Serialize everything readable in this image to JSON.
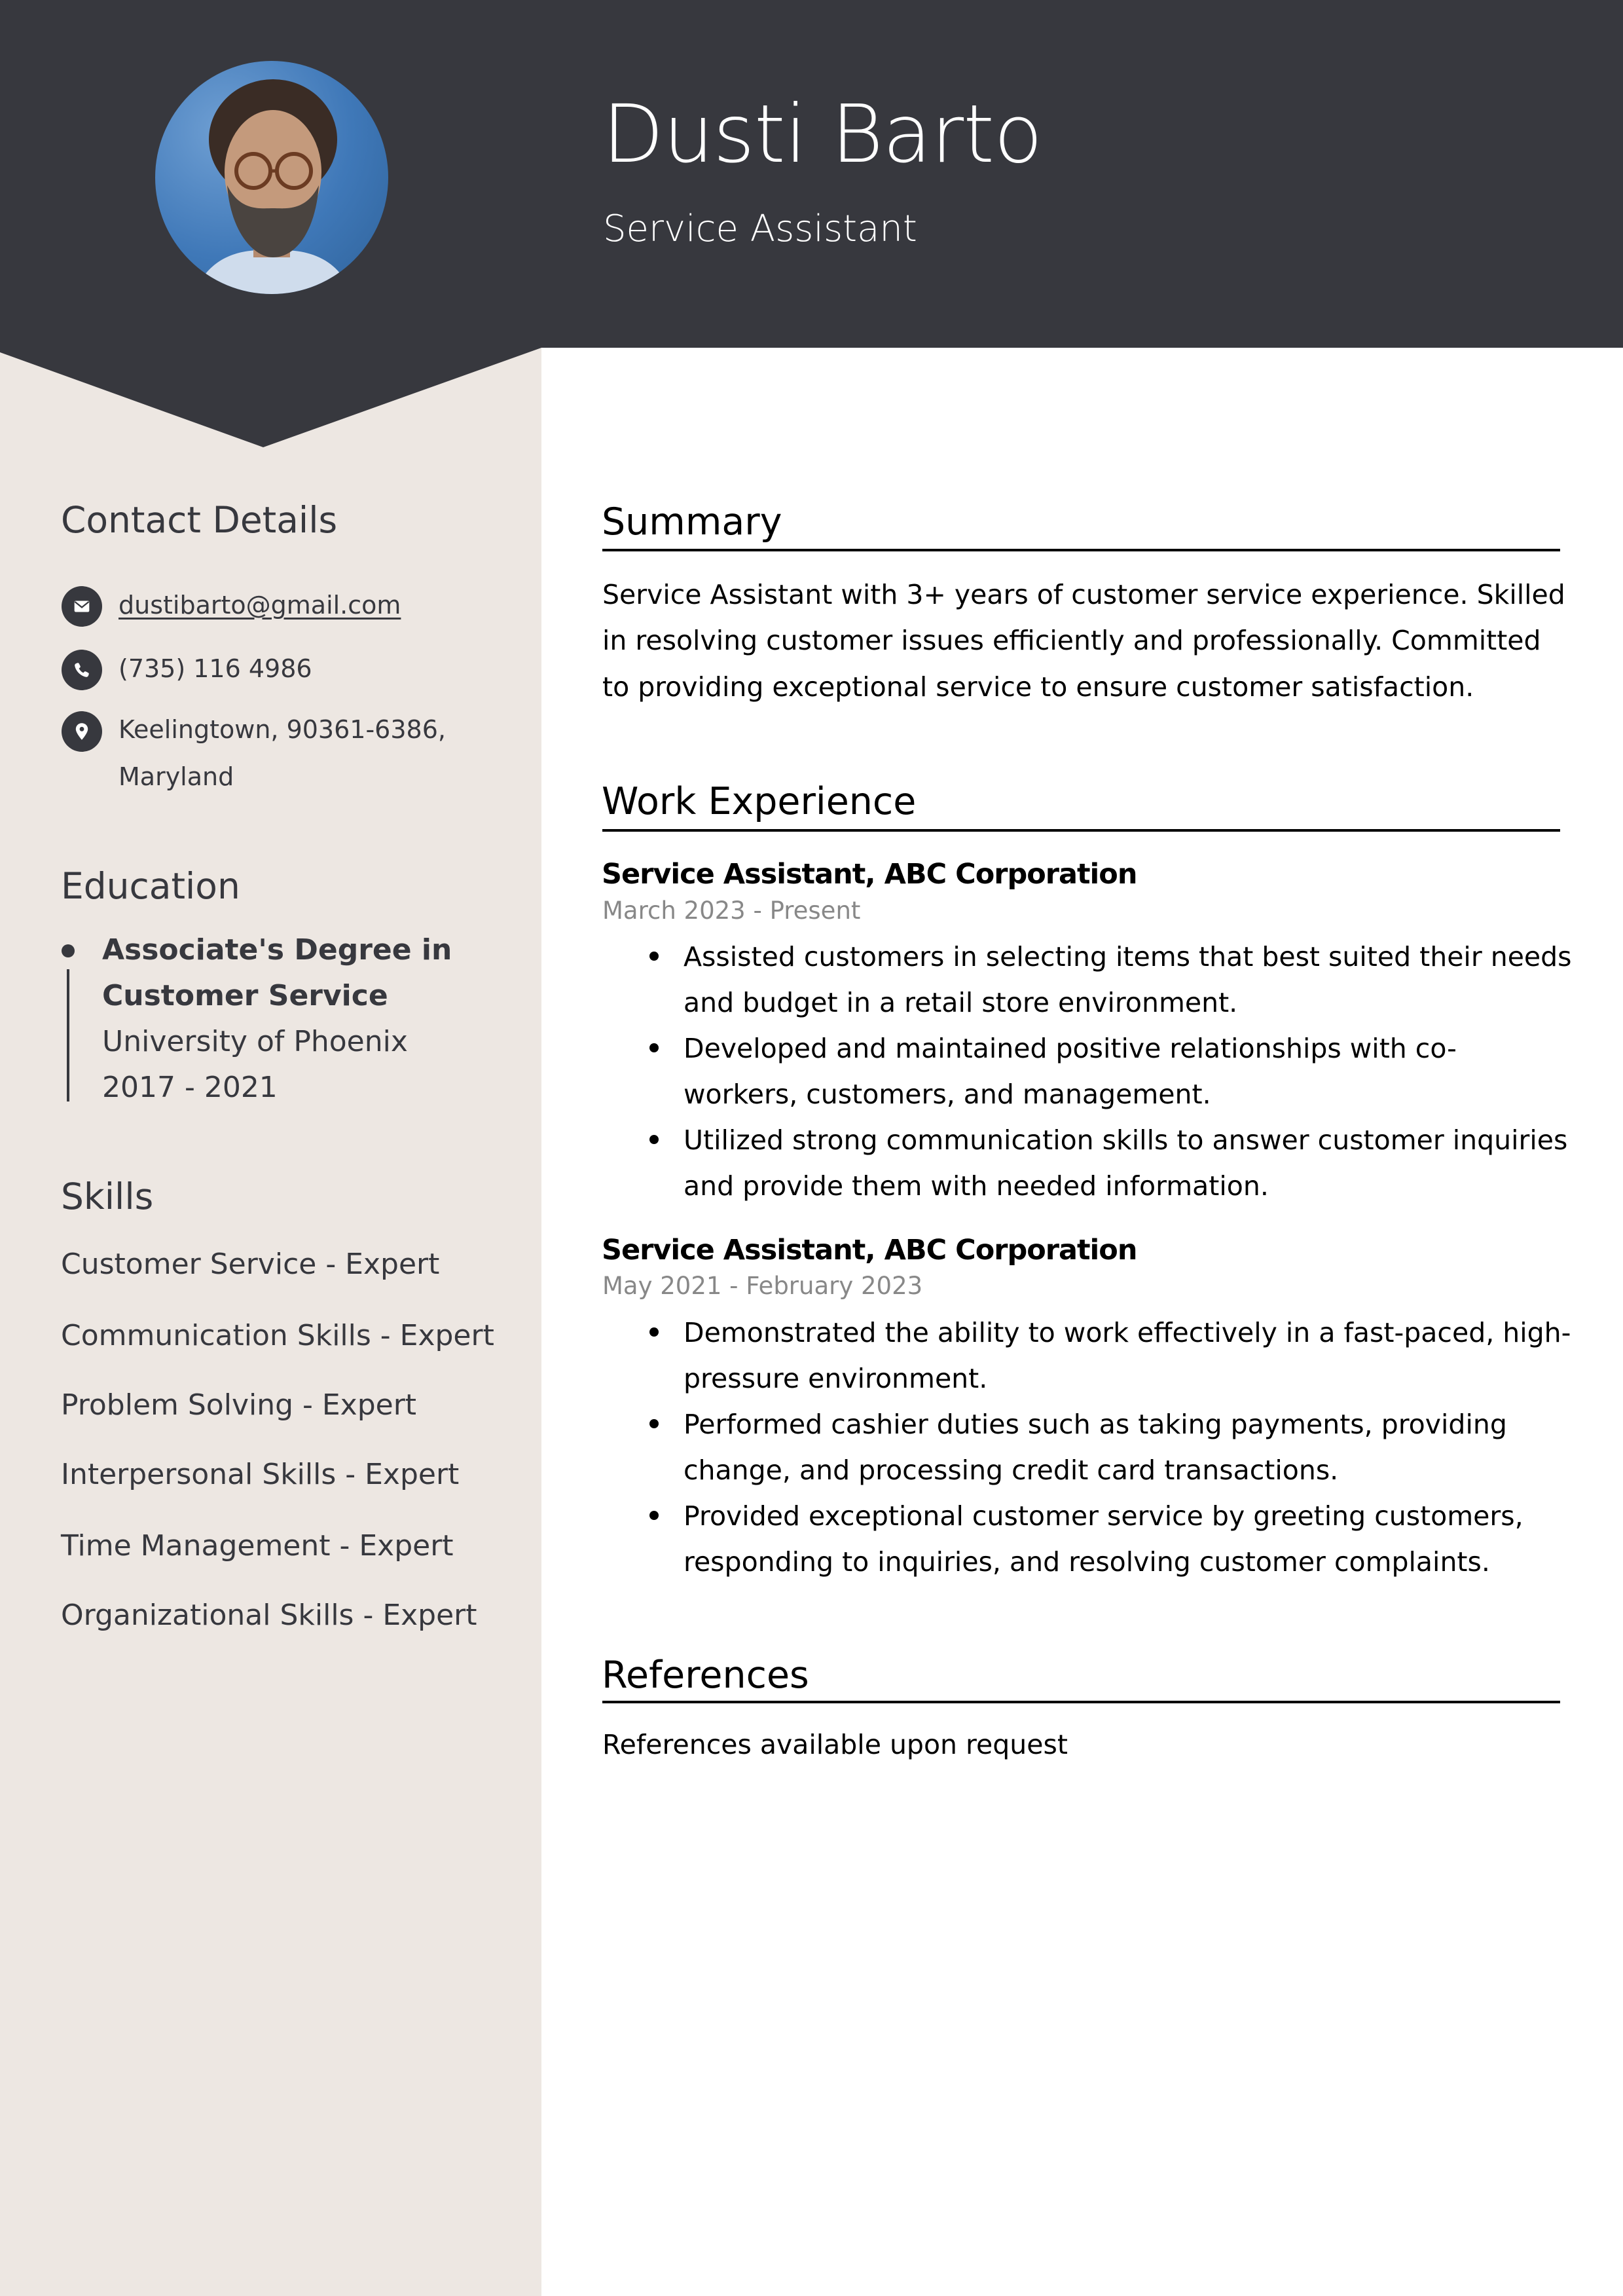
{
  "header": {
    "name": "Dusti Barto",
    "title": "Service Assistant",
    "photo_alt": "profile-photo"
  },
  "colors": {
    "header_bg": "#37383e",
    "sidebar_bg": "#ede7e2",
    "sidebar_text": "#37383e",
    "main_text": "#000000",
    "date_text": "#888888"
  },
  "sidebar": {
    "contact": {
      "heading": "Contact Details",
      "email": {
        "icon": "envelope-icon",
        "value": "dustibarto@gmail.com"
      },
      "phone": {
        "icon": "phone-icon",
        "value": "(735) 116 4986"
      },
      "address": {
        "icon": "map-pin-icon",
        "line1": "Keelingtown, 90361-6386,",
        "line2": "Maryland"
      }
    },
    "education": {
      "heading": "Education",
      "items": [
        {
          "degree_line1": "Associate's Degree in",
          "degree_line2": "Customer Service",
          "school": "University of Phoenix",
          "years": "2017 - 2021"
        }
      ]
    },
    "skills": {
      "heading": "Skills",
      "items": [
        "Customer Service - Expert",
        "Communication Skills - Expert",
        "Problem Solving - Expert",
        "Interpersonal Skills - Expert",
        "Time Management - Expert",
        "Organizational Skills - Expert"
      ]
    }
  },
  "main": {
    "summary": {
      "heading": "Summary",
      "lines": [
        "Service Assistant with 3+ years of customer service experience. Skilled",
        "in resolving customer issues efficiently and professionally. Committed",
        "to providing exceptional service to ensure customer satisfaction."
      ]
    },
    "experience": {
      "heading": "Work Experience",
      "jobs": [
        {
          "title": "Service Assistant, ABC Corporation",
          "dates": "March 2023 - Present",
          "bullets": [
            [
              "Assisted customers in selecting items that best suited their needs",
              "and budget in a retail store environment."
            ],
            [
              "Developed and maintained positive relationships with co-",
              "workers, customers, and management."
            ],
            [
              "Utilized strong communication skills to answer customer inquiries",
              "and provide them with needed information."
            ]
          ]
        },
        {
          "title": "Service Assistant, ABC Corporation",
          "dates": "May 2021 - February 2023",
          "bullets": [
            [
              "Demonstrated the ability to work effectively in a fast-paced, high-",
              "pressure environment."
            ],
            [
              "Performed cashier duties such as taking payments, providing",
              "change, and processing credit card transactions."
            ],
            [
              "Provided exceptional customer service by greeting customers,",
              "responding to inquiries, and resolving customer complaints."
            ]
          ]
        }
      ]
    },
    "references": {
      "heading": "References",
      "text": "References available upon request"
    }
  }
}
